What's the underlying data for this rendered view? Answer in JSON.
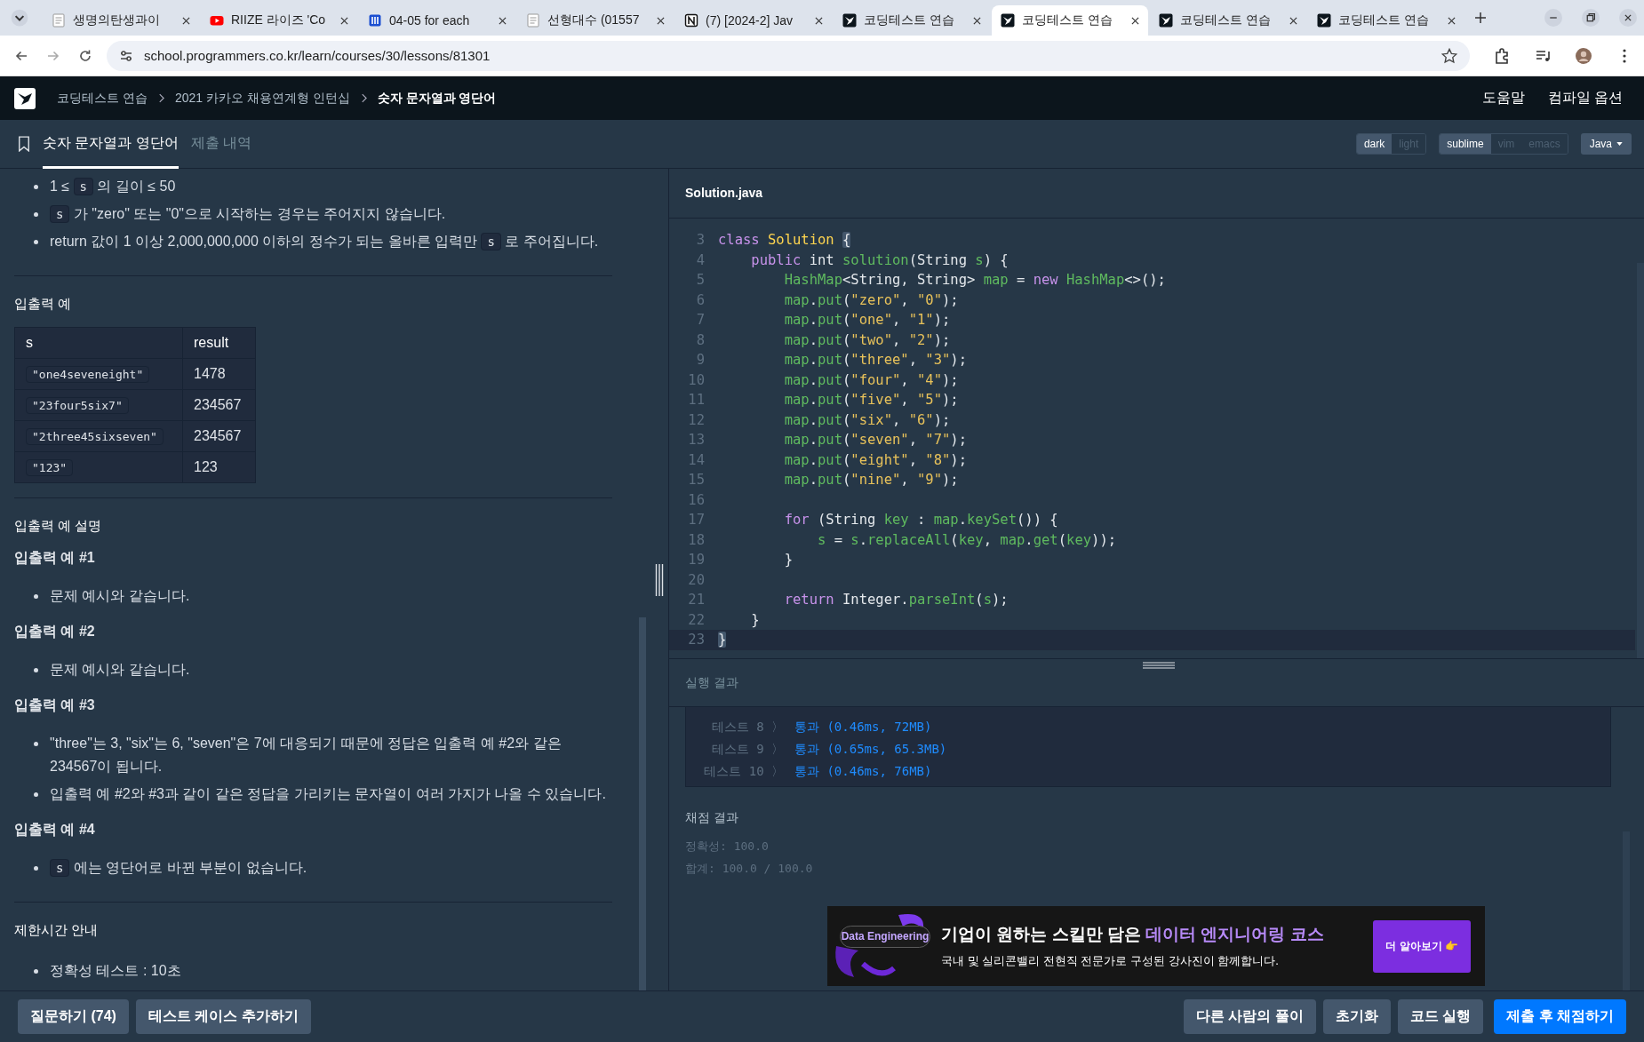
{
  "browser": {
    "tabs": [
      {
        "title": "생명의탄생과이",
        "kind": "doc",
        "selected": false
      },
      {
        "title": "RIIZE 라이즈 'Co",
        "kind": "video",
        "selected": false
      },
      {
        "title": "04-05 for each",
        "kind": "book",
        "selected": false
      },
      {
        "title": "선형대수 (01557",
        "kind": "doc",
        "selected": false
      },
      {
        "title": "(7) [2024-2] Jav",
        "kind": "notion",
        "selected": false
      },
      {
        "title": "코딩테스트 연습",
        "kind": "site",
        "selected": false
      },
      {
        "title": "코딩테스트 연습",
        "kind": "site",
        "selected": true
      },
      {
        "title": "코딩테스트 연습",
        "kind": "site",
        "selected": false
      },
      {
        "title": "코딩테스트 연습",
        "kind": "site",
        "selected": false
      }
    ],
    "url": "school.programmers.co.kr/learn/courses/30/lessons/81301"
  },
  "nav": {
    "breadcrumb": [
      "코딩테스트 연습",
      "2021 카카오 채용연계형 인턴십",
      "숫자 문자열과 영단어"
    ],
    "links": [
      "도움말",
      "컴파일 옵션"
    ]
  },
  "subheader": {
    "tabs": [
      {
        "label": "숫자 문자열과 영단어",
        "selected": true
      },
      {
        "label": "제출 내역",
        "selected": false
      }
    ],
    "themes": [
      {
        "label": "dark",
        "selected": true
      },
      {
        "label": "light",
        "selected": false
      }
    ],
    "keymaps": [
      {
        "label": "sublime",
        "selected": true
      },
      {
        "label": "vim",
        "selected": false
      },
      {
        "label": "emacs",
        "selected": false
      }
    ],
    "language": "Java"
  },
  "problem": {
    "constraints": [
      [
        {
          "kind": "text",
          "text": "1 ≤ "
        },
        {
          "kind": "code",
          "text": "s"
        },
        {
          "kind": "text",
          "text": " 의 길이 ≤ 50"
        }
      ],
      [
        {
          "kind": "code",
          "text": "s"
        },
        {
          "kind": "text",
          "text": " 가 \"zero\" 또는 \"0\"으로 시작하는 경우는 주어지지 않습니다."
        }
      ],
      [
        {
          "kind": "text",
          "text": "return 값이 1 이상 2,000,000,000 이하의 정수가 되는 올바른 입력만 "
        },
        {
          "kind": "code",
          "text": "s"
        },
        {
          "kind": "text",
          "text": " 로 주어집니다."
        }
      ]
    ],
    "examples_title": "입출력 예",
    "table": {
      "columns": [
        "s",
        "result"
      ],
      "rows": [
        [
          "\"one4seveneight\"",
          "1478"
        ],
        [
          "\"23four5six7\"",
          "234567"
        ],
        [
          "\"2three45sixseven\"",
          "234567"
        ],
        [
          "\"123\"",
          "123"
        ]
      ]
    },
    "explanation_title": "입출력 예 설명",
    "explanations": [
      {
        "title": "입출력 예 #1",
        "items": [
          [
            {
              "kind": "text",
              "text": "문제 예시와 같습니다."
            }
          ]
        ]
      },
      {
        "title": "입출력 예 #2",
        "items": [
          [
            {
              "kind": "text",
              "text": "문제 예시와 같습니다."
            }
          ]
        ]
      },
      {
        "title": "입출력 예 #3",
        "items": [
          [
            {
              "kind": "text",
              "text": "\"three\"는 3, \"six\"는 6, \"seven\"은 7에 대응되기 때문에 정답은 입출력 예 #2와 같은 234567이 됩니다."
            }
          ],
          [
            {
              "kind": "text",
              "text": "입출력 예 #2와 #3과 같이 같은 정답을 가리키는 문자열이 여러 가지가 나올 수 있습니다."
            }
          ]
        ]
      },
      {
        "title": "입출력 예 #4",
        "items": [
          [
            {
              "kind": "code",
              "text": "s"
            },
            {
              "kind": "text",
              "text": " 에는 영단어로 바뀐 부분이 없습니다."
            }
          ]
        ]
      }
    ],
    "time_title": "제한시간 안내",
    "time_items": [
      [
        {
          "kind": "text",
          "text": "정확성 테스트 : 10초"
        }
      ]
    ]
  },
  "editor": {
    "filename": "Solution.java",
    "lines": [
      {
        "no": "3",
        "current": false,
        "tokens": [
          {
            "kind": "kw",
            "text": "class "
          },
          {
            "kind": "type",
            "text": "Solution "
          },
          {
            "kind": "match",
            "text": "{"
          }
        ]
      },
      {
        "no": "4",
        "current": false,
        "tokens": [
          {
            "kind": "kw",
            "text": "    public "
          },
          {
            "kind": "p",
            "text": "int "
          },
          {
            "kind": "fn",
            "text": "solution"
          },
          {
            "kind": "p",
            "text": "(String "
          },
          {
            "kind": "fn",
            "text": "s"
          },
          {
            "kind": "p",
            "text": ") {"
          }
        ]
      },
      {
        "no": "5",
        "current": false,
        "tokens": [
          {
            "kind": "fn",
            "text": "        HashMap"
          },
          {
            "kind": "p",
            "text": "<String, String> "
          },
          {
            "kind": "fn",
            "text": "map"
          },
          {
            "kind": "p",
            "text": " = "
          },
          {
            "kind": "kw",
            "text": "new "
          },
          {
            "kind": "fn",
            "text": "HashMap"
          },
          {
            "kind": "p",
            "text": "<>();"
          }
        ]
      },
      {
        "no": "6",
        "current": false,
        "tokens": [
          {
            "kind": "fn",
            "text": "        map"
          },
          {
            "kind": "p",
            "text": "."
          },
          {
            "kind": "fn",
            "text": "put"
          },
          {
            "kind": "p",
            "text": "("
          },
          {
            "kind": "str",
            "text": "\"zero\""
          },
          {
            "kind": "p",
            "text": ", "
          },
          {
            "kind": "str",
            "text": "\"0\""
          },
          {
            "kind": "p",
            "text": ");"
          }
        ]
      },
      {
        "no": "7",
        "current": false,
        "tokens": [
          {
            "kind": "fn",
            "text": "        map"
          },
          {
            "kind": "p",
            "text": "."
          },
          {
            "kind": "fn",
            "text": "put"
          },
          {
            "kind": "p",
            "text": "("
          },
          {
            "kind": "str",
            "text": "\"one\""
          },
          {
            "kind": "p",
            "text": ", "
          },
          {
            "kind": "str",
            "text": "\"1\""
          },
          {
            "kind": "p",
            "text": ");"
          }
        ]
      },
      {
        "no": "8",
        "current": false,
        "tokens": [
          {
            "kind": "fn",
            "text": "        map"
          },
          {
            "kind": "p",
            "text": "."
          },
          {
            "kind": "fn",
            "text": "put"
          },
          {
            "kind": "p",
            "text": "("
          },
          {
            "kind": "str",
            "text": "\"two\""
          },
          {
            "kind": "p",
            "text": ", "
          },
          {
            "kind": "str",
            "text": "\"2\""
          },
          {
            "kind": "p",
            "text": ");"
          }
        ]
      },
      {
        "no": "9",
        "current": false,
        "tokens": [
          {
            "kind": "fn",
            "text": "        map"
          },
          {
            "kind": "p",
            "text": "."
          },
          {
            "kind": "fn",
            "text": "put"
          },
          {
            "kind": "p",
            "text": "("
          },
          {
            "kind": "str",
            "text": "\"three\""
          },
          {
            "kind": "p",
            "text": ", "
          },
          {
            "kind": "str",
            "text": "\"3\""
          },
          {
            "kind": "p",
            "text": ");"
          }
        ]
      },
      {
        "no": "10",
        "current": false,
        "tokens": [
          {
            "kind": "fn",
            "text": "        map"
          },
          {
            "kind": "p",
            "text": "."
          },
          {
            "kind": "fn",
            "text": "put"
          },
          {
            "kind": "p",
            "text": "("
          },
          {
            "kind": "str",
            "text": "\"four\""
          },
          {
            "kind": "p",
            "text": ", "
          },
          {
            "kind": "str",
            "text": "\"4\""
          },
          {
            "kind": "p",
            "text": ");"
          }
        ]
      },
      {
        "no": "11",
        "current": false,
        "tokens": [
          {
            "kind": "fn",
            "text": "        map"
          },
          {
            "kind": "p",
            "text": "."
          },
          {
            "kind": "fn",
            "text": "put"
          },
          {
            "kind": "p",
            "text": "("
          },
          {
            "kind": "str",
            "text": "\"five\""
          },
          {
            "kind": "p",
            "text": ", "
          },
          {
            "kind": "str",
            "text": "\"5\""
          },
          {
            "kind": "p",
            "text": ");"
          }
        ]
      },
      {
        "no": "12",
        "current": false,
        "tokens": [
          {
            "kind": "fn",
            "text": "        map"
          },
          {
            "kind": "p",
            "text": "."
          },
          {
            "kind": "fn",
            "text": "put"
          },
          {
            "kind": "p",
            "text": "("
          },
          {
            "kind": "str",
            "text": "\"six\""
          },
          {
            "kind": "p",
            "text": ", "
          },
          {
            "kind": "str",
            "text": "\"6\""
          },
          {
            "kind": "p",
            "text": ");"
          }
        ]
      },
      {
        "no": "13",
        "current": false,
        "tokens": [
          {
            "kind": "fn",
            "text": "        map"
          },
          {
            "kind": "p",
            "text": "."
          },
          {
            "kind": "fn",
            "text": "put"
          },
          {
            "kind": "p",
            "text": "("
          },
          {
            "kind": "str",
            "text": "\"seven\""
          },
          {
            "kind": "p",
            "text": ", "
          },
          {
            "kind": "str",
            "text": "\"7\""
          },
          {
            "kind": "p",
            "text": ");"
          }
        ]
      },
      {
        "no": "14",
        "current": false,
        "tokens": [
          {
            "kind": "fn",
            "text": "        map"
          },
          {
            "kind": "p",
            "text": "."
          },
          {
            "kind": "fn",
            "text": "put"
          },
          {
            "kind": "p",
            "text": "("
          },
          {
            "kind": "str",
            "text": "\"eight\""
          },
          {
            "kind": "p",
            "text": ", "
          },
          {
            "kind": "str",
            "text": "\"8\""
          },
          {
            "kind": "p",
            "text": ");"
          }
        ]
      },
      {
        "no": "15",
        "current": false,
        "tokens": [
          {
            "kind": "fn",
            "text": "        map"
          },
          {
            "kind": "p",
            "text": "."
          },
          {
            "kind": "fn",
            "text": "put"
          },
          {
            "kind": "p",
            "text": "("
          },
          {
            "kind": "str",
            "text": "\"nine\""
          },
          {
            "kind": "p",
            "text": ", "
          },
          {
            "kind": "str",
            "text": "\"9\""
          },
          {
            "kind": "p",
            "text": ");"
          }
        ]
      },
      {
        "no": "16",
        "current": false
      },
      {
        "no": "17",
        "current": false,
        "tokens": [
          {
            "kind": "kw",
            "text": "        for "
          },
          {
            "kind": "p",
            "text": "(String "
          },
          {
            "kind": "fn",
            "text": "key"
          },
          {
            "kind": "p",
            "text": " : "
          },
          {
            "kind": "fn",
            "text": "map"
          },
          {
            "kind": "p",
            "text": "."
          },
          {
            "kind": "fn",
            "text": "keySet"
          },
          {
            "kind": "p",
            "text": "()) {"
          }
        ]
      },
      {
        "no": "18",
        "current": false,
        "tokens": [
          {
            "kind": "fn",
            "text": "            s"
          },
          {
            "kind": "p",
            "text": " = "
          },
          {
            "kind": "fn",
            "text": "s"
          },
          {
            "kind": "p",
            "text": "."
          },
          {
            "kind": "fn",
            "text": "replaceAll"
          },
          {
            "kind": "p",
            "text": "("
          },
          {
            "kind": "fn",
            "text": "key"
          },
          {
            "kind": "p",
            "text": ", "
          },
          {
            "kind": "fn",
            "text": "map"
          },
          {
            "kind": "p",
            "text": "."
          },
          {
            "kind": "fn",
            "text": "get"
          },
          {
            "kind": "p",
            "text": "("
          },
          {
            "kind": "fn",
            "text": "key"
          },
          {
            "kind": "p",
            "text": "));"
          }
        ]
      },
      {
        "no": "19",
        "current": false,
        "tokens": [
          {
            "kind": "p",
            "text": "        }"
          }
        ]
      },
      {
        "no": "20",
        "current": false
      },
      {
        "no": "21",
        "current": false,
        "tokens": [
          {
            "kind": "kw",
            "text": "        return "
          },
          {
            "kind": "p",
            "text": "Integer."
          },
          {
            "kind": "fn",
            "text": "parseInt"
          },
          {
            "kind": "p",
            "text": "("
          },
          {
            "kind": "fn",
            "text": "s"
          },
          {
            "kind": "p",
            "text": ");"
          }
        ]
      },
      {
        "no": "22",
        "current": false,
        "tokens": [
          {
            "kind": "p",
            "text": "    }"
          }
        ]
      },
      {
        "no": "23",
        "current": true,
        "tokens": [
          {
            "kind": "match",
            "text": "}"
          }
        ]
      }
    ]
  },
  "results": {
    "title": "실행 결과",
    "tests": [
      {
        "label": "테스트 8 〉",
        "result": "통과 (0.46ms, 72MB)"
      },
      {
        "label": "테스트 9 〉",
        "result": "통과 (0.65ms, 65.3MB)"
      },
      {
        "label": "테스트 10 〉",
        "result": "통과 (0.46ms, 76MB)"
      }
    ],
    "grading_title": "채점 결과",
    "grading": [
      "정확성: 100.0",
      "합계: 100.0 / 100.0"
    ]
  },
  "ad": {
    "badge": "Data Engineering",
    "headline": [
      {
        "kind": "text",
        "text": "기업이 원하는 스킬만 담은 "
      },
      {
        "kind": "highlight",
        "text": "데이터 엔지니어링 코스"
      }
    ],
    "subline": "국내 및 실리콘밸리 전현직 전문가로 구성된 강사진이 함께합니다.",
    "button": "더 알아보기 👉"
  },
  "footer": {
    "left_buttons": [
      "질문하기 (74)",
      "테스트 케이스 추가하기"
    ],
    "right_buttons": [
      {
        "label": "다른 사람의 풀이",
        "primary": false
      },
      {
        "label": "초기화",
        "primary": false
      },
      {
        "label": "코드 실행",
        "primary": false
      },
      {
        "label": "제출 후 채점하기",
        "primary": true
      }
    ]
  }
}
